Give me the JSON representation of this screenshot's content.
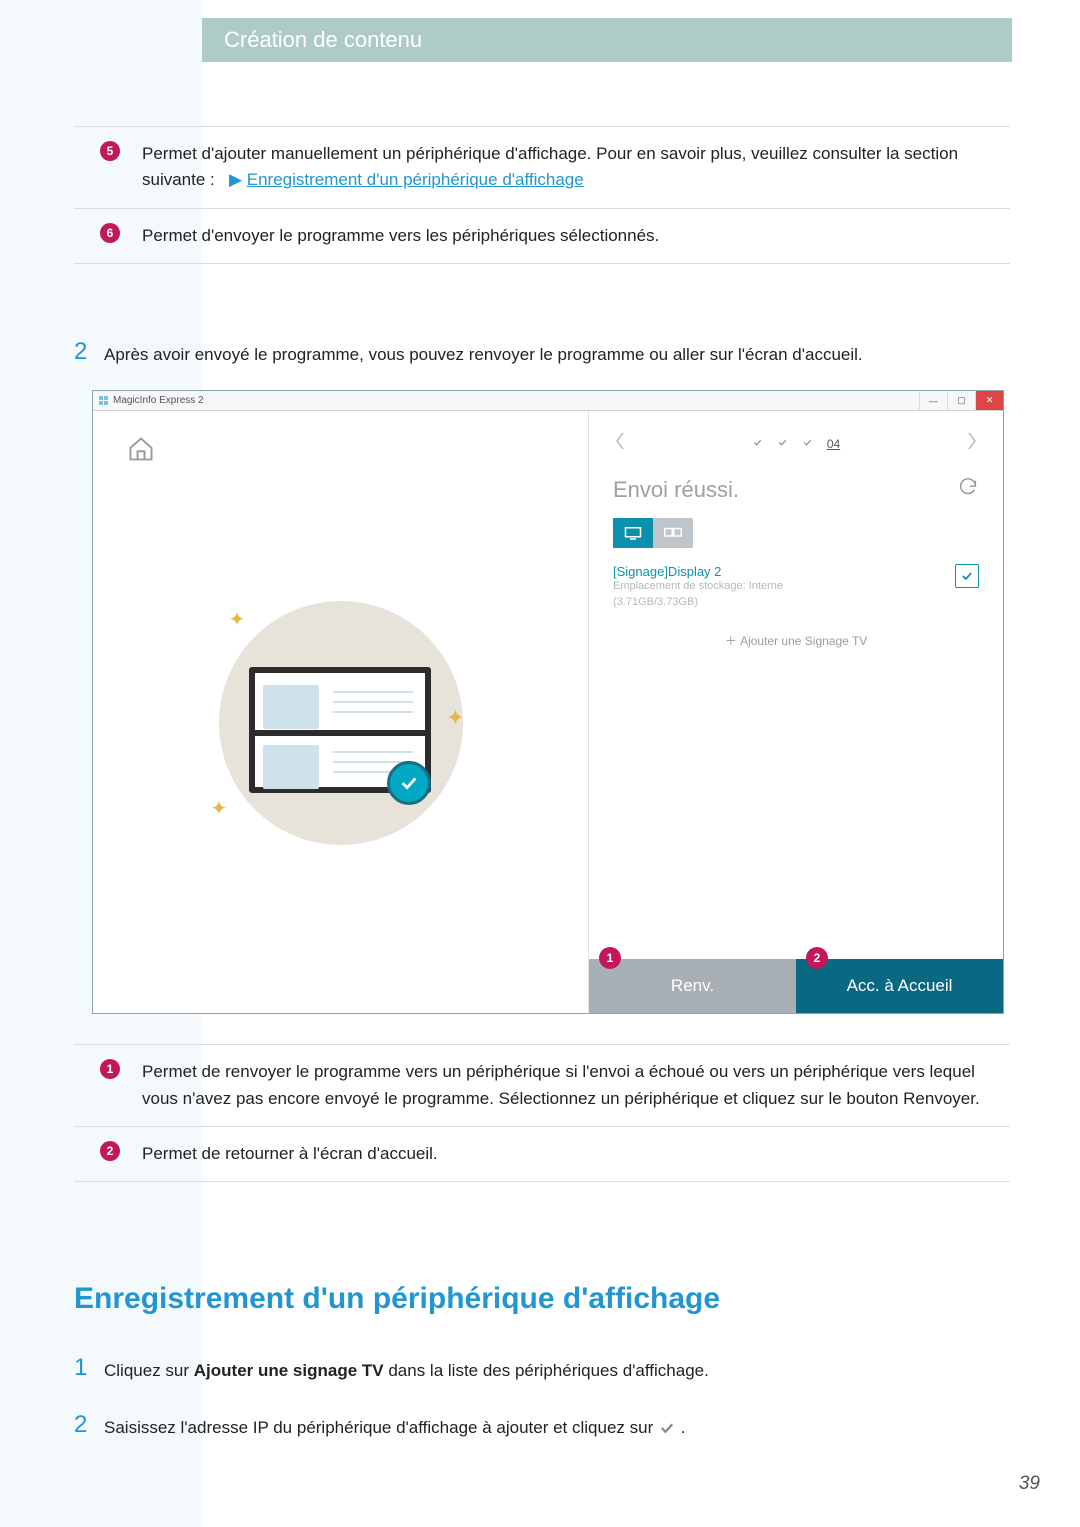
{
  "header": {
    "title": "Création de contenu"
  },
  "topTable": {
    "rows": [
      {
        "num": "5",
        "text_a": "Permet d'ajouter manuellement un périphérique d'affichage. Pour en savoir plus, veuillez consulter la section suivante :",
        "link": "Enregistrement d'un périphérique d'affichage"
      },
      {
        "num": "6",
        "text_a": "Permet d'envoyer le programme vers les périphériques sélectionnés."
      }
    ]
  },
  "step2": {
    "num": "2",
    "text": "Après avoir envoyé le programme, vous pouvez renvoyer le programme ou aller sur l'écran d'accueil."
  },
  "app": {
    "title": "MagicInfo Express 2",
    "stepBadge": "04",
    "paneTitle": "Envoi réussi.",
    "deviceName": "[Signage]Display 2",
    "storageLine1": "Emplacement de stockage: Interne",
    "storageLine2": "(3.71GB/3.73GB)",
    "addTv": "Ajouter une Signage TV",
    "btnRenv": "Renv.",
    "btnHome": "Acc. à Accueil",
    "calloutA": "1",
    "calloutB": "2"
  },
  "bottomTable": {
    "rows": [
      {
        "num": "1",
        "text": "Permet de renvoyer le programme vers un périphérique si l'envoi a échoué ou vers un périphérique vers lequel vous n'avez pas encore envoyé le programme. Sélectionnez un périphérique et cliquez sur le bouton Renvoyer."
      },
      {
        "num": "2",
        "text": "Permet de retourner à l'écran d'accueil."
      }
    ]
  },
  "section": {
    "title": "Enregistrement d'un périphérique d'affichage",
    "steps": [
      {
        "num": "1",
        "pre": "Cliquez sur ",
        "bold": "Ajouter une signage TV",
        "post": " dans la liste des périphériques d'affichage."
      },
      {
        "num": "2",
        "pre": "Saisissez l'adresse IP du périphérique d'affichage à ajouter et cliquez sur ",
        "post": " ."
      }
    ]
  },
  "pageNumber": "39"
}
